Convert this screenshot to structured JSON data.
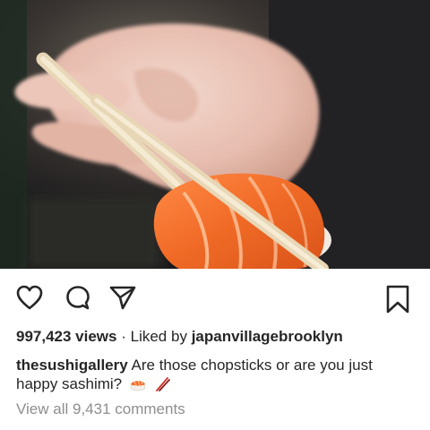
{
  "post": {
    "photo_icon": "sushi-photo",
    "actions": {
      "like_icon": "heart-icon",
      "comment_icon": "comment-bubble-icon",
      "share_icon": "paper-plane-icon",
      "save_icon": "bookmark-icon"
    },
    "views": "997,423 views",
    "separator": "·",
    "liked_by_prefix": "Liked by",
    "liked_by_user": "japanvillagebrooklyn",
    "caption": {
      "username": "thesushigallery",
      "text": "Are those chopsticks or are you just happy sashimi?",
      "emojis": [
        "sushi-emoji",
        "chopsticks-emoji"
      ]
    },
    "view_comments": "View all 9,431 comments"
  },
  "colors": {
    "text": "#262626",
    "muted": "#8e8e8e",
    "salmon": "#f26d2c"
  }
}
